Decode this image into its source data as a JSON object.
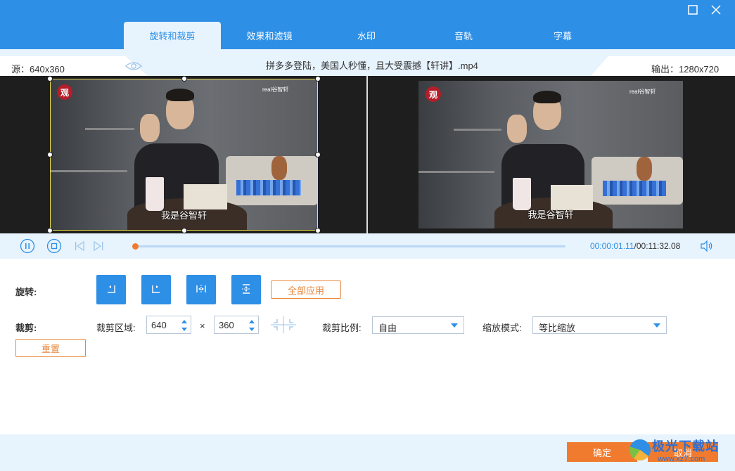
{
  "window": {
    "maximize_icon": "maximize-icon",
    "close_icon": "close-icon"
  },
  "tabs": [
    {
      "label": "旋转和裁剪",
      "active": true
    },
    {
      "label": "效果和滤镜",
      "active": false
    },
    {
      "label": "水印",
      "active": false
    },
    {
      "label": "音轨",
      "active": false
    },
    {
      "label": "字幕",
      "active": false
    }
  ],
  "info": {
    "source": "源：640x360",
    "filename": "拼多多登陆，美国人秒懂，且大受震撼【轩讲】.mp4",
    "output": "输出：1280x720",
    "eye_icon": "eye-icon"
  },
  "video": {
    "subtitle": "我是谷智轩",
    "watermark": "real谷智轩",
    "logo_text": "观"
  },
  "playback": {
    "current_time": "00:00:01.11",
    "total_time": "/00:11:32.08",
    "progress": 0.0
  },
  "rotate": {
    "label": "旋转:",
    "apply_all": "全部应用",
    "buttons": [
      "rotate-left-icon",
      "rotate-right-icon",
      "flip-horizontal-icon",
      "flip-vertical-icon"
    ]
  },
  "crop": {
    "label": "裁剪:",
    "area_label": "裁剪区域:",
    "width": "640",
    "times": "×",
    "height": "360",
    "ratio_label": "裁剪比例:",
    "ratio_value": "自由",
    "zoom_label": "缩放模式:",
    "zoom_value": "等比缩放",
    "reset": "重置"
  },
  "footer": {
    "confirm": "确定",
    "cancel": "取消",
    "site_name": "极光下载站",
    "site_url": "www.xz7.com"
  },
  "colors": {
    "accent": "#2e8fe6",
    "orange": "#f07b2e",
    "light_bg": "#e7f3fd"
  }
}
